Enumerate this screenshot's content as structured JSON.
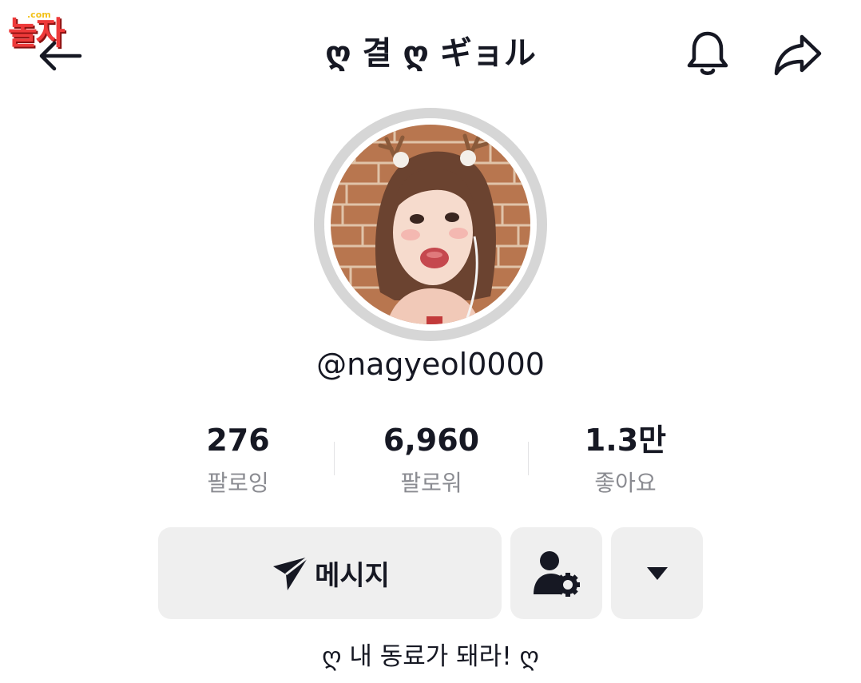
{
  "watermark": {
    "logo_text": "놀자",
    "logo_dot": ".com"
  },
  "header": {
    "back_icon": "arrow-left-icon",
    "title": "ღ 결 ღ ギョル",
    "bell_icon": "bell-icon",
    "share_icon": "share-arrow-icon"
  },
  "profile": {
    "avatar_icon": "profile-avatar",
    "username": "@nagyeol0000"
  },
  "stats": [
    {
      "value": "276",
      "label": "팔로잉"
    },
    {
      "value": "6,960",
      "label": "팔로워"
    },
    {
      "value": "1.3만",
      "label": "좋아요"
    }
  ],
  "actions": {
    "message_label": "메시지",
    "message_icon": "send-icon",
    "profile_settings_icon": "user-gear-icon",
    "more_icon": "caret-down-icon"
  },
  "bio": "ღ 내 동료가 돼라! ღ",
  "colors": {
    "primary_text": "#161823",
    "secondary_text": "#8a8b91",
    "button_bg": "#efefef",
    "avatar_ring": "#d6d6d6",
    "watermark_red": "#ee3a3a"
  }
}
